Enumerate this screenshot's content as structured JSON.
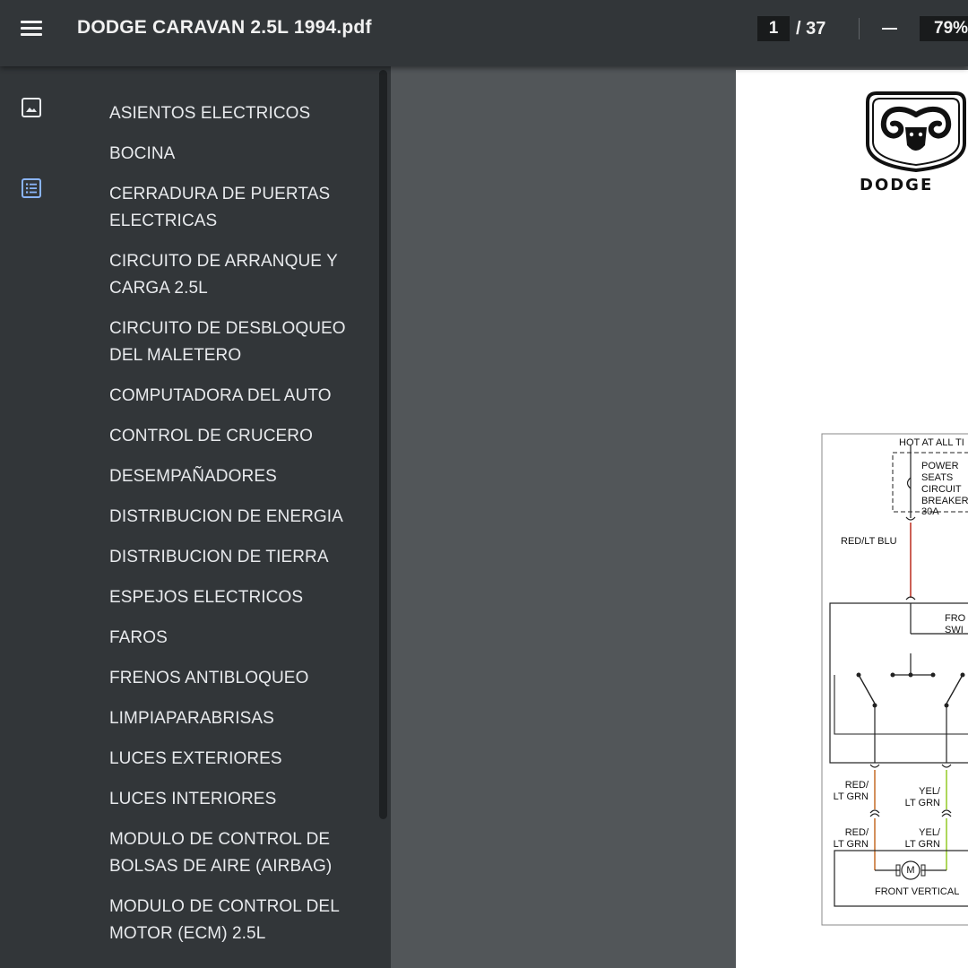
{
  "toolbar": {
    "title": "DODGE CARAVAN 2.5L 1994.pdf",
    "current_page": "1",
    "page_separator": "/ 37",
    "zoom": "79%"
  },
  "sidebar": {
    "items": [
      "ASIENTOS ELECTRICOS",
      "BOCINA",
      "CERRADURA DE PUERTAS ELECTRICAS",
      "CIRCUITO DE ARRANQUE Y CARGA 2.5L",
      "CIRCUITO DE DESBLOQUEO DEL MALETERO",
      "COMPUTADORA DEL AUTO",
      "CONTROL DE CRUCERO",
      "DESEMPAÑADORES",
      "DISTRIBUCION DE ENERGIA",
      "DISTRIBUCION DE TIERRA",
      "ESPEJOS ELECTRICOS",
      "FAROS",
      "FRENOS ANTIBLOQUEO",
      "LIMPIAPARABRISAS",
      "LUCES EXTERIORES",
      "LUCES INTERIORES",
      "MODULO DE CONTROL DE BOLSAS DE AIRE (AIRBAG)",
      "MODULO DE CONTROL DEL MOTOR (ECM) 2.5L"
    ]
  },
  "page": {
    "logo_text": "DODGE",
    "diagram": {
      "hot_label": "HOT AT ALL TI",
      "breaker_label_1": "POWER",
      "breaker_label_2": "SEATS",
      "breaker_label_3": "CIRCUIT",
      "breaker_label_4": "BREAKER",
      "breaker_label_5": "30A",
      "wire_1": "RED/LT BLU",
      "switch_label_1": "FRO",
      "switch_label_2": "SWI",
      "wire_2a": "RED/",
      "wire_2b": "LT GRN",
      "wire_3a": "YEL/",
      "wire_3b": "LT GRN",
      "wire_4a": "RED/",
      "wire_4b": "LT GRN",
      "wire_5a": "YEL/",
      "wire_5b": "LT GRN",
      "motor_symbol": "M",
      "motor_label": "FRONT VERTICAL"
    }
  },
  "colors": {
    "toolbar": "#323639",
    "sidebar": "#323639",
    "viewer": "#525659",
    "outline_icon_active": "#8ab4f8",
    "wire_red": "#c0392b",
    "wire_red_grn": "#c87533",
    "wire_yel_grn": "#9acd32"
  }
}
